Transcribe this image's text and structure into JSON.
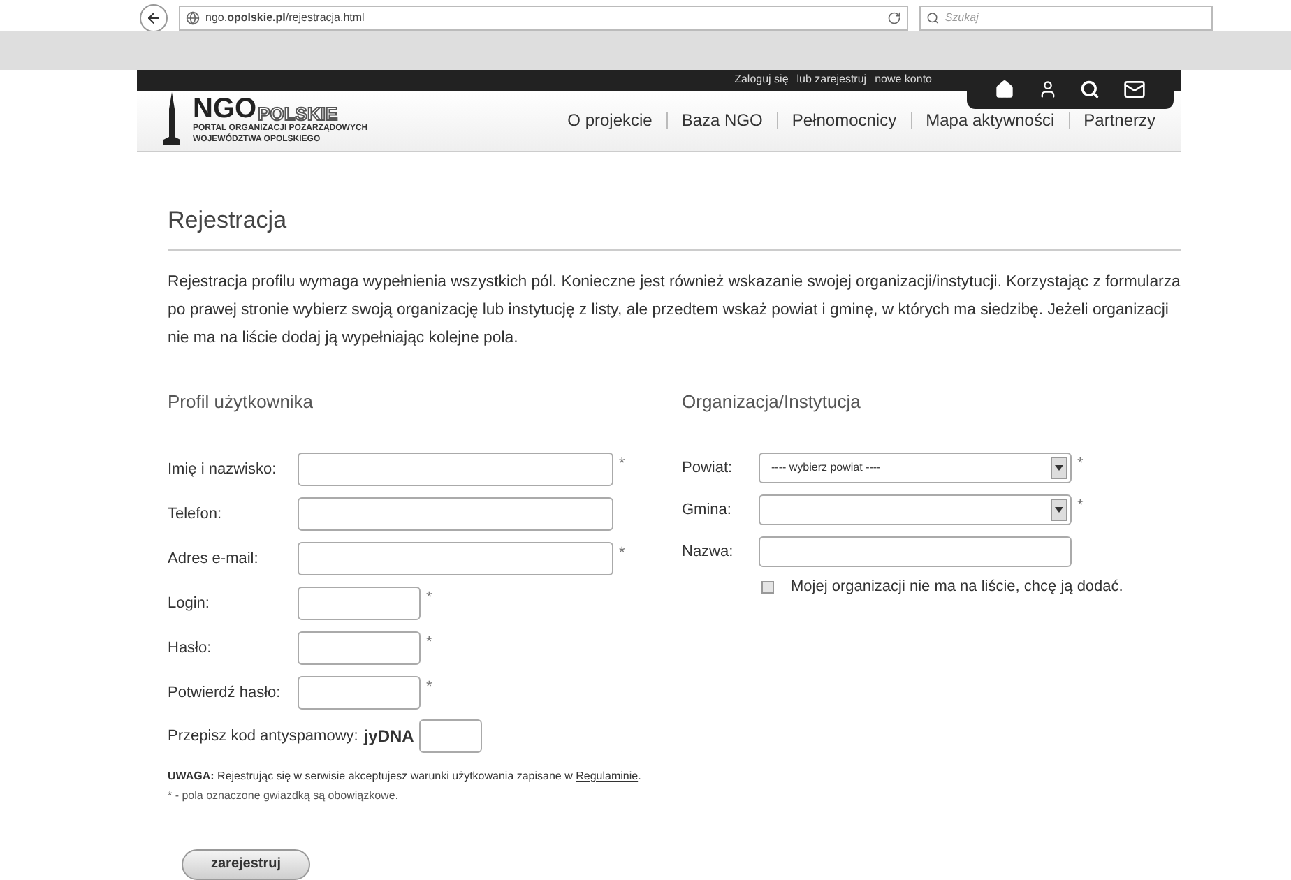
{
  "browser": {
    "url": "ngo.**opolskie.pl**/rejestracja.html",
    "search_placeholder": "Szukaj"
  },
  "topbar": {
    "links": [
      "Zaloguj się",
      "lub zarejestruj",
      "nowe konto"
    ]
  },
  "logo": {
    "main": "NGO",
    "sub": "POLSKIE",
    "tagline": [
      "PORTAL ORGANIZACJI POZARZĄDOWYCH",
      "WOJEWÓDZTWA OPOLSKIEGO"
    ]
  },
  "nav": [
    "O projekcie",
    "Baza NGO",
    "Pełnomocnicy",
    "Mapa aktywności",
    "Partnerzy"
  ],
  "title": "Rejestracja",
  "intro": "Rejestracja profilu wymaga wypełnienia wszystkich pól. Konieczne jest również wskazanie swojej organizacji/instytucji. Korzystając z formularza po prawej stronie wybierz swoją organizację lub instytucję z listy, ale przedtem wskaż powiat i gminę, w których ma siedzibę. Jeżeli organizacji nie ma na liście dodaj ją wypełniając kolejne pola.",
  "profile": {
    "heading": "Profil użytkownika",
    "fields": [
      {
        "label": "Imię i nazwisko:",
        "kind": "wide",
        "mark": "*"
      },
      {
        "label": "Telefon:",
        "kind": "wide"
      },
      {
        "label": "Adres e-mail:",
        "kind": "wide",
        "mark": "*"
      },
      {
        "label": "Login:",
        "kind": "short",
        "mark": "*"
      },
      {
        "label": "Hasło:",
        "kind": "short",
        "mark": "*"
      },
      {
        "label": "Potwierdź hasło:",
        "kind": "short",
        "mark": "*"
      }
    ]
  },
  "antispam": {
    "label": "Przepisz kod antyspamowy:",
    "code": "jyDNA"
  },
  "organization": {
    "heading": "Organizacja/Instytucja",
    "fields": [
      {
        "label": "Powiat:",
        "kind": "select",
        "value": "---- wybierz powiat ----",
        "mark": "*"
      },
      {
        "label": "Gmina:",
        "kind": "select",
        "mark": "*"
      },
      {
        "label": "Nazwa:",
        "kind": "text"
      }
    ],
    "checkbox": {
      "label": "Mojej organizacji nie ma na liście, chcę ją dodać.",
      "checked": false
    }
  },
  "notice": {
    "text": "**UWAGA:** Rejestrując się w serwisie akceptujesz warunki użytkowania zapisane w",
    "link": "Regulaminie",
    "end": ".",
    "footnote": "* - pola oznaczone gwiazdką są obowiązkowe."
  },
  "submit": "zarejestruj"
}
